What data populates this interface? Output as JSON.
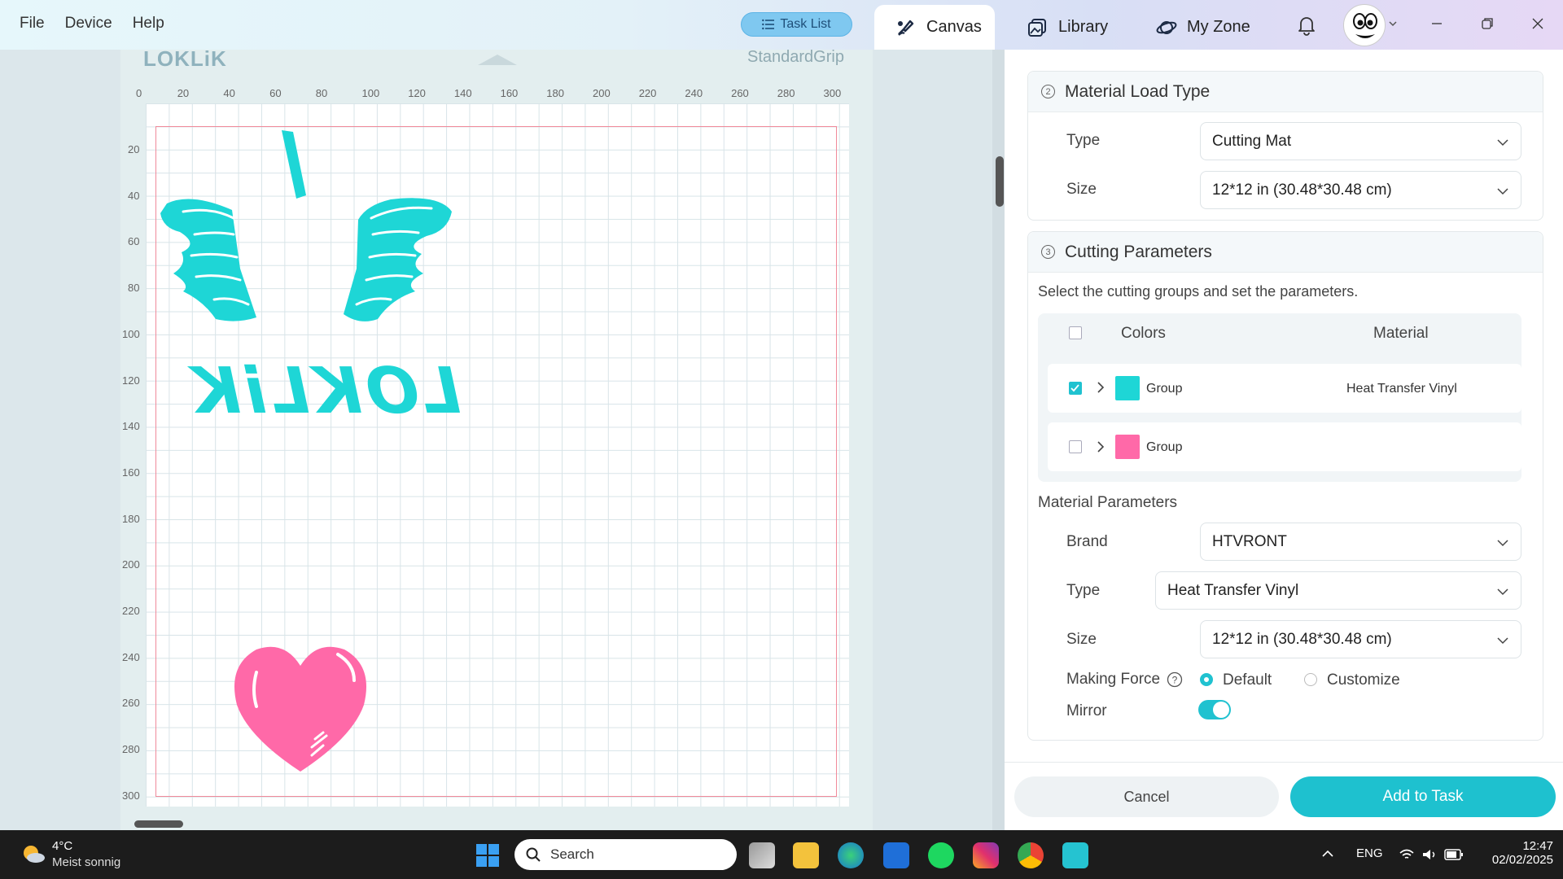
{
  "menu": {
    "file": "File",
    "device": "Device",
    "help": "Help"
  },
  "header": {
    "task_list": "Task List",
    "tabs": [
      {
        "label": "Canvas",
        "icon": "canvas-icon",
        "active": true
      },
      {
        "label": "Library",
        "icon": "library-icon",
        "active": false
      },
      {
        "label": "My Zone",
        "icon": "my-zone-icon",
        "active": false
      }
    ]
  },
  "mat": {
    "logo": "LOKLiK",
    "grip": "StandardGrip",
    "ruler_x": [
      "0",
      "20",
      "40",
      "60",
      "80",
      "100",
      "120",
      "140",
      "160",
      "180",
      "200",
      "220",
      "240",
      "260",
      "280",
      "300"
    ],
    "ruler_y": [
      "20",
      "40",
      "60",
      "80",
      "100",
      "120",
      "140",
      "160",
      "180",
      "200",
      "220",
      "240",
      "260",
      "280",
      "300"
    ],
    "mirrored_text": "LOKLiK",
    "colors": {
      "cyan": "#1ed6d6",
      "pink": "#ff69a8"
    }
  },
  "panel": {
    "material_load": {
      "step": "2",
      "title": "Material Load Type",
      "type_label": "Type",
      "type_value": "Cutting Mat",
      "size_label": "Size",
      "size_value": "12*12 in (30.48*30.48 cm)"
    },
    "cutting": {
      "step": "3",
      "title": "Cutting Parameters",
      "hint": "Select the cutting groups and set the parameters.",
      "col_colors": "Colors",
      "col_material": "Material",
      "groups": [
        {
          "name": "Group",
          "color": "#1ed6d6",
          "material": "Heat Transfer Vinyl",
          "checked": true
        },
        {
          "name": "Group",
          "color": "#ff69a8",
          "material": "",
          "checked": false
        }
      ]
    },
    "material_params": {
      "title": "Material Parameters",
      "brand_label": "Brand",
      "brand_value": "HTVRONT",
      "type_label": "Type",
      "type_value": "Heat Transfer Vinyl",
      "size_label": "Size",
      "size_value": "12*12 in (30.48*30.48 cm)",
      "force_label": "Making Force",
      "force_default": "Default",
      "force_custom": "Customize",
      "force_selected": "Default",
      "mirror_label": "Mirror",
      "mirror_on": true
    },
    "cancel": "Cancel",
    "add_to_task": "Add to Task"
  },
  "taskbar": {
    "temp": "4°C",
    "weather": "Meist sonnig",
    "search": "Search",
    "lang": "ENG",
    "time": "12:47",
    "date": "02/02/2025"
  }
}
